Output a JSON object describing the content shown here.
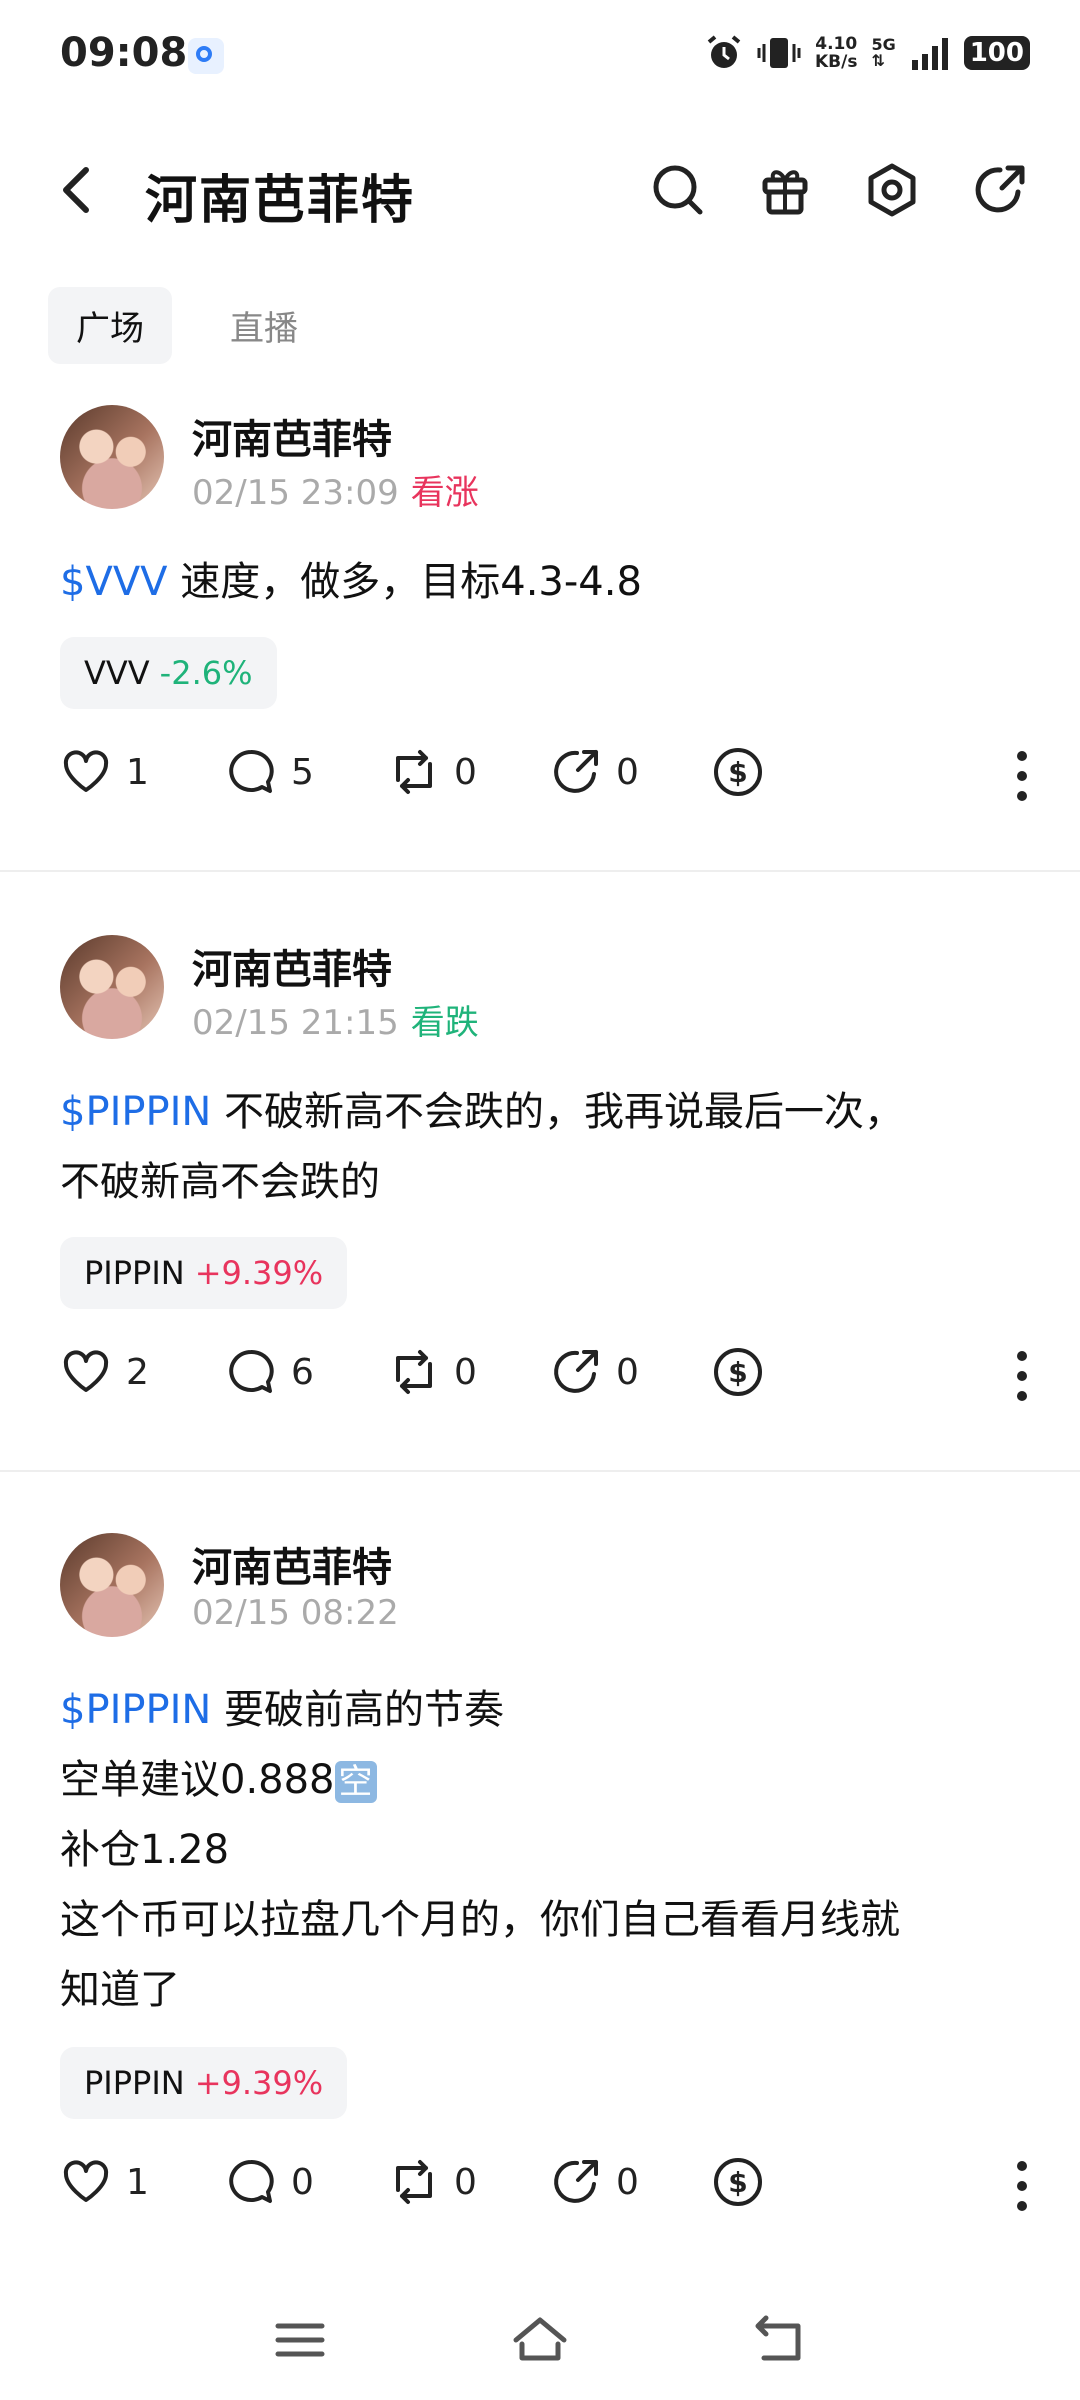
{
  "status_bar": {
    "time": "09:08",
    "speed_value": "4.10",
    "speed_unit": "KB/s",
    "network": "5G",
    "battery": "100"
  },
  "header": {
    "title": "河南芭菲特",
    "icons": [
      "back-icon",
      "search-icon",
      "gift-icon",
      "settings-icon",
      "share-icon"
    ]
  },
  "tabs": [
    {
      "label": "广场",
      "active": true
    },
    {
      "label": "直播",
      "active": false
    }
  ],
  "posts": [
    {
      "username": "河南芭菲特",
      "time": "02/15 23:09",
      "sentiment": "看涨",
      "sentiment_color": "#e8345d",
      "ticker": "$VVV",
      "lines": [
        " 速度，做多，目标4.3-4.8"
      ],
      "chip_symbol": "VVV",
      "chip_change": "-2.6%",
      "likes": "1",
      "comments": "5",
      "reposts": "0",
      "shares": "0"
    },
    {
      "username": "河南芭菲特",
      "time": "02/15 21:15",
      "sentiment": "看跌",
      "sentiment_color": "#1fb37a",
      "ticker": "$PIPPIN",
      "lines": [
        " 不破新高不会跌的，我再说最后一次，",
        "不破新高不会跌的"
      ],
      "chip_symbol": "PIPPIN",
      "chip_change": "+9.39%",
      "likes": "2",
      "comments": "6",
      "reposts": "0",
      "shares": "0"
    },
    {
      "username": "河南芭菲特",
      "time": "02/15 08:22",
      "sentiment": "",
      "ticker": "$PIPPIN",
      "lines": [
        " 要破前高的节奏",
        "空单建议0.888",
        "补仓1.28",
        "这个币可以拉盘几个月的，你们自己看看月线就",
        "知道了"
      ],
      "emoji": "空",
      "chip_symbol": "PIPPIN",
      "chip_change": "+9.39%",
      "likes": "1",
      "comments": "0",
      "reposts": "0",
      "shares": "0"
    }
  ],
  "nav_bar": [
    "menu-icon",
    "home-icon",
    "return-icon"
  ]
}
